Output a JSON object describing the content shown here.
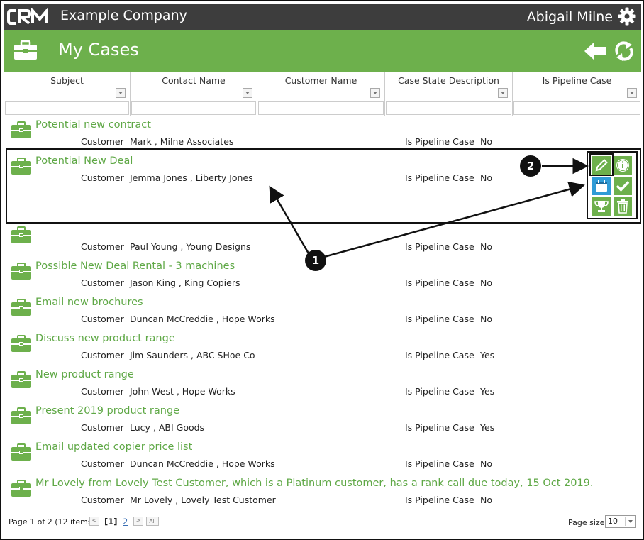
{
  "header": {
    "logo_text": "CRM",
    "company": "Example Company",
    "user": "Abigail Milne"
  },
  "titlebar": {
    "title": "My Cases"
  },
  "columns": [
    {
      "label": "Subject"
    },
    {
      "label": "Contact Name"
    },
    {
      "label": "Customer Name"
    },
    {
      "label": "Case State Description"
    },
    {
      "label": "Is Pipeline Case"
    }
  ],
  "field_labels": {
    "customer": "Customer",
    "pipeline": "Is Pipeline Case"
  },
  "cases": [
    {
      "subject": "Potential new contract",
      "customer": "Mark , Milne Associates",
      "pipeline": "No"
    },
    {
      "subject": "Potential New Deal",
      "customer": "Jemma Jones , Liberty Jones",
      "pipeline": "No"
    },
    {
      "subject": "",
      "customer": "Paul Young , Young Designs",
      "pipeline": "No"
    },
    {
      "subject": "Possible New Deal Rental - 3 machines",
      "customer": "Jason King , King Copiers",
      "pipeline": "No"
    },
    {
      "subject": "Email new brochures",
      "customer": "Duncan McCreddie , Hope Works",
      "pipeline": "No"
    },
    {
      "subject": "Discuss new product range",
      "customer": "Jim Saunders , ABC SHoe Co",
      "pipeline": "Yes"
    },
    {
      "subject": "New product range",
      "customer": "John West , Hope Works",
      "pipeline": "Yes"
    },
    {
      "subject": "Present 2019 product range",
      "customer": "Lucy , ABI Goods",
      "pipeline": "Yes"
    },
    {
      "subject": "Email updated copier price list",
      "customer": "Duncan McCreddie , Hope Works",
      "pipeline": "No"
    },
    {
      "subject": "Mr Lovely from Lovely Test Customer, which is a Platinum customer, has a rank call due today, 15 Oct 2019.",
      "customer": "Mr Lovely , Lovely Test Customer",
      "pipeline": "No"
    }
  ],
  "annotations": {
    "badge_1": "1",
    "badge_2": "2"
  },
  "pager": {
    "info": "Page 1 of 2 (12 items)",
    "prev": "<",
    "current": "[1]",
    "next_page": "2",
    "next": ">",
    "all": "All",
    "page_size_label": "Page size:",
    "page_size": "10"
  },
  "colors": {
    "topbar": "#3d3d3d",
    "accent": "#6db04c",
    "subject_text": "#5fa846",
    "info_blue": "#2f9bd6"
  },
  "icons": {
    "title": "briefcase-icon",
    "back": "back-arrow-icon",
    "refresh": "refresh-icon",
    "settings": "gear-icon",
    "actions": [
      "edit-icon",
      "info-icon",
      "calendar-icon",
      "check-icon",
      "trophy-icon",
      "trash-icon"
    ]
  }
}
